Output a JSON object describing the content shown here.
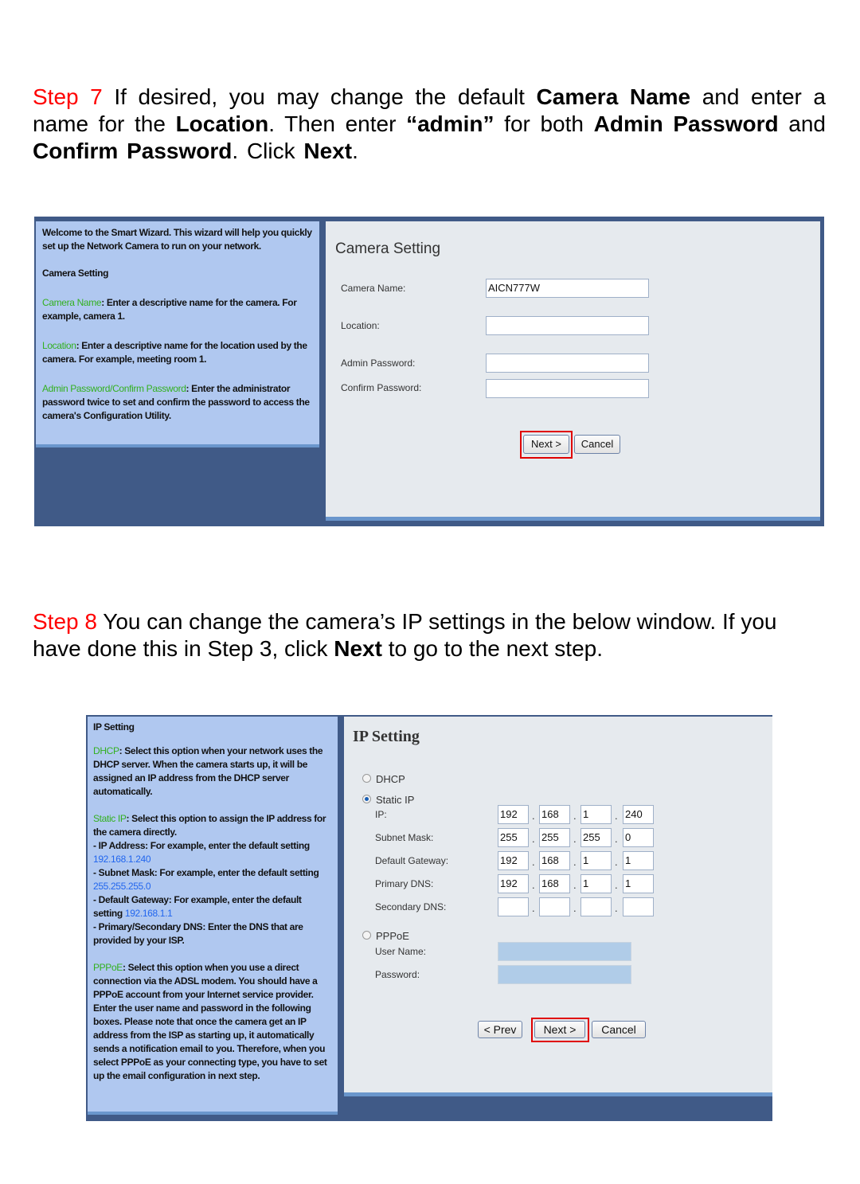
{
  "step7": {
    "segments": [
      {
        "t": "Step 7",
        "style": "red"
      },
      {
        "t": " If desired, you may change the default "
      },
      {
        "t": "Camera Name",
        "style": "b"
      },
      {
        "t": " and enter a name for the "
      },
      {
        "t": "Location",
        "style": "b"
      },
      {
        "t": ".  Then enter "
      },
      {
        "t": "“admin”",
        "style": "b"
      },
      {
        "t": " for both "
      },
      {
        "t": "Admin Password",
        "style": "b"
      },
      {
        "t": " and "
      },
      {
        "t": "Confirm Password",
        "style": "b"
      },
      {
        "t": ".  Click "
      },
      {
        "t": "Next",
        "style": "b"
      },
      {
        "t": "."
      }
    ]
  },
  "camera_setting": {
    "help": {
      "intro": "Welcome to the Smart Wizard. This wizard will help you quickly set up the Network Camera to run on your network.",
      "heading": "Camera Setting",
      "items": [
        {
          "term": "Camera Name",
          "text": ": Enter a descriptive name for the camera. For example, camera 1."
        },
        {
          "term": "Location",
          "text": ": Enter a descriptive name for the location used by the camera. For example, meeting room 1."
        },
        {
          "term": "Admin Password/Confirm Password",
          "text": ": Enter the administrator password twice to set and confirm the password to access the camera's Configuration Utility."
        }
      ]
    },
    "title": "Camera Setting",
    "fields": [
      {
        "label": "Camera Name:",
        "value": "AICN777W"
      },
      {
        "label": "Location:",
        "value": ""
      },
      {
        "label": "Admin Password:",
        "value": ""
      },
      {
        "label": "Confirm Password:",
        "value": ""
      }
    ],
    "next_label": "Next >",
    "cancel_label": "Cancel"
  },
  "step8": {
    "segments": [
      {
        "t": "Step 8",
        "style": "red"
      },
      {
        "t": " You can change the camera’s IP settings in the below window. If you have done this in Step 3, click "
      },
      {
        "t": "Next",
        "style": "b"
      },
      {
        "t": " to go to the next step."
      }
    ]
  },
  "ip_setting": {
    "help": {
      "heading": "IP Setting",
      "dhcp_term": "DHCP",
      "dhcp_text": ": Select this option when your network uses the DHCP server. When the camera starts up, it will be assigned an IP address from the DHCP server automatically.",
      "static_term": "Static IP",
      "static_text": ": Select this option to assign the IP address for the camera directly.",
      "ip_text": "- IP Address: For example, enter the default setting ",
      "ip_value": "192.168.1.240",
      "mask_text": "- Subnet Mask: For example, enter the default setting ",
      "mask_value": "255.255.255.0",
      "gw_text": "- Default Gateway: For example, enter the default setting ",
      "gw_value": "192.168.1.1",
      "dns_text": "- Primary/Secondary DNS: Enter the DNS that are provided by your ISP.",
      "pppoe_term": "PPPoE",
      "pppoe_text": ": Select this option when you use a direct connection via the ADSL modem. You should have a PPPoE account from your Internet service provider. Enter the user name and password in the following boxes. Please note that once the camera get an IP address from the ISP as starting up, it automatically sends a notification email to you. Therefore, when you select PPPoE as your connecting type, you have to set up the email configuration in next step."
    },
    "title": "IP Setting",
    "options": [
      {
        "label": "DHCP",
        "selected": false
      },
      {
        "label": "Static IP",
        "selected": true
      },
      {
        "label": "PPPoE",
        "selected": false
      }
    ],
    "static_rows": [
      {
        "label": "IP:",
        "octets": [
          "192",
          "168",
          "1",
          "240"
        ]
      },
      {
        "label": "Subnet Mask:",
        "octets": [
          "255",
          "255",
          "255",
          "0"
        ]
      },
      {
        "label": "Default Gateway:",
        "octets": [
          "192",
          "168",
          "1",
          "1"
        ]
      },
      {
        "label": "Primary DNS:",
        "octets": [
          "192",
          "168",
          "1",
          "1"
        ]
      },
      {
        "label": "Secondary DNS:",
        "octets": [
          "",
          "",
          "",
          ""
        ]
      }
    ],
    "separator": ".",
    "pppoe_fields": [
      {
        "label": "User Name:",
        "value": ""
      },
      {
        "label": "Password:",
        "value": ""
      }
    ],
    "prev_label": "< Prev",
    "next_label": "Next >",
    "cancel_label": "Cancel"
  },
  "colors": {
    "step_red": "#ff0000",
    "help_bg": "#b0c8f0",
    "frame": "#405a87",
    "term_green": "#33b020",
    "value_blue": "#2266ee",
    "highlight": "#e00000"
  }
}
